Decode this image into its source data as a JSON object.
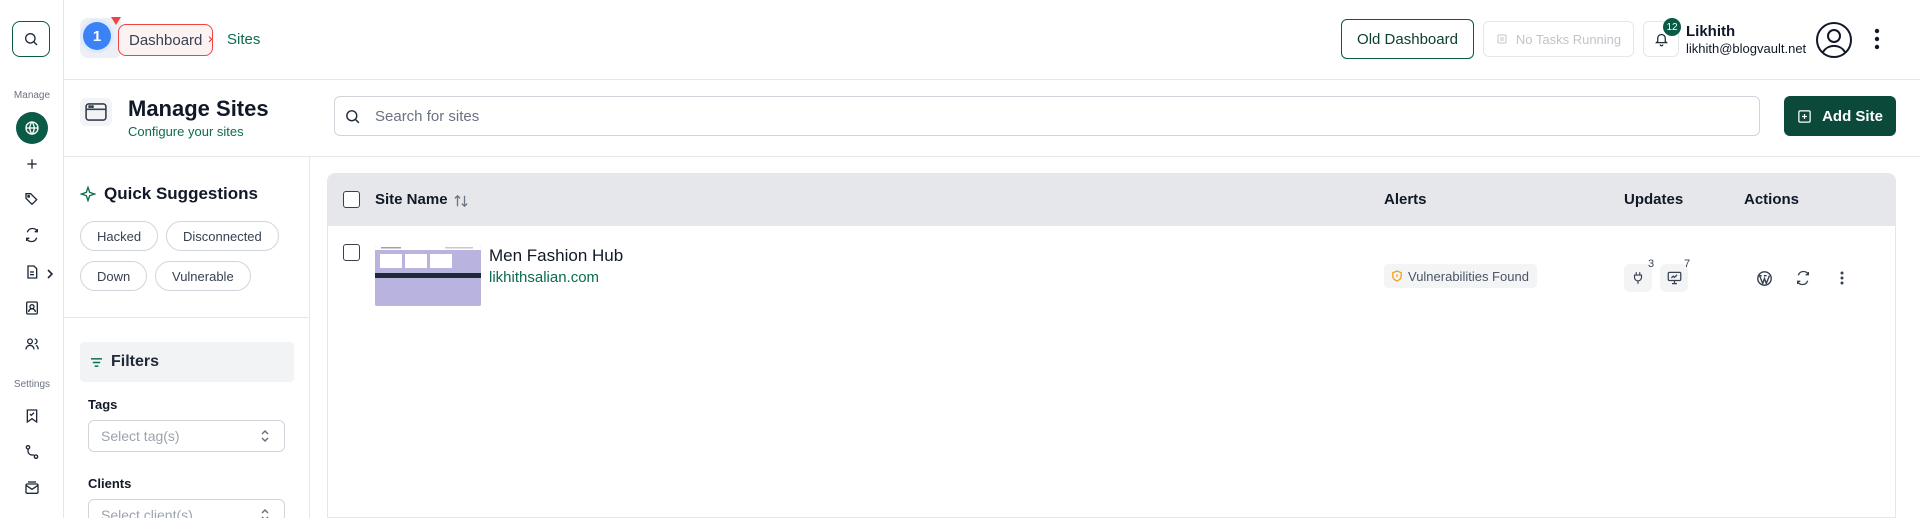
{
  "breadcrumb": {
    "step_number": "1",
    "dashboard": "Dashboard",
    "separator": "›",
    "current": "Sites"
  },
  "header": {
    "old_dashboard": "Old Dashboard",
    "tasks_status": "No Tasks Running",
    "notification_count": "12",
    "user_name": "Likhith",
    "user_email": "likhith@blogvault.net"
  },
  "rail": {
    "manage_label": "Manage",
    "settings_label": "Settings",
    "icons": [
      "search-icon",
      "globe-icon",
      "plus-icon",
      "tags-icon",
      "sync-icon",
      "report-icon",
      "contacts-icon",
      "users-icon",
      "bookmark-icon",
      "git-branch-icon",
      "mailbox-icon"
    ]
  },
  "page": {
    "title": "Manage Sites",
    "subtitle": "Configure your sites",
    "search_placeholder": "Search for sites",
    "add_button": "Add Site"
  },
  "suggestions": {
    "title": "Quick Suggestions",
    "chips": [
      "Hacked",
      "Disconnected",
      "Down",
      "Vulnerable"
    ]
  },
  "filters": {
    "title": "Filters",
    "tags_label": "Tags",
    "tags_placeholder": "Select tag(s)",
    "clients_label": "Clients",
    "clients_placeholder": "Select client(s)"
  },
  "table": {
    "columns": {
      "site_name": "Site Name",
      "alerts": "Alerts",
      "updates": "Updates",
      "actions": "Actions"
    },
    "rows": [
      {
        "name": "Men Fashion Hub",
        "url": "likhithsalian.com",
        "alert": "Vulnerabilities Found",
        "plugin_updates": "3",
        "theme_updates": "7"
      }
    ]
  },
  "colors": {
    "brand": "#0b5a45",
    "accent_text": "#0b6b50",
    "tour_red": "#ef4444",
    "tour_blue": "#3b82f6"
  }
}
